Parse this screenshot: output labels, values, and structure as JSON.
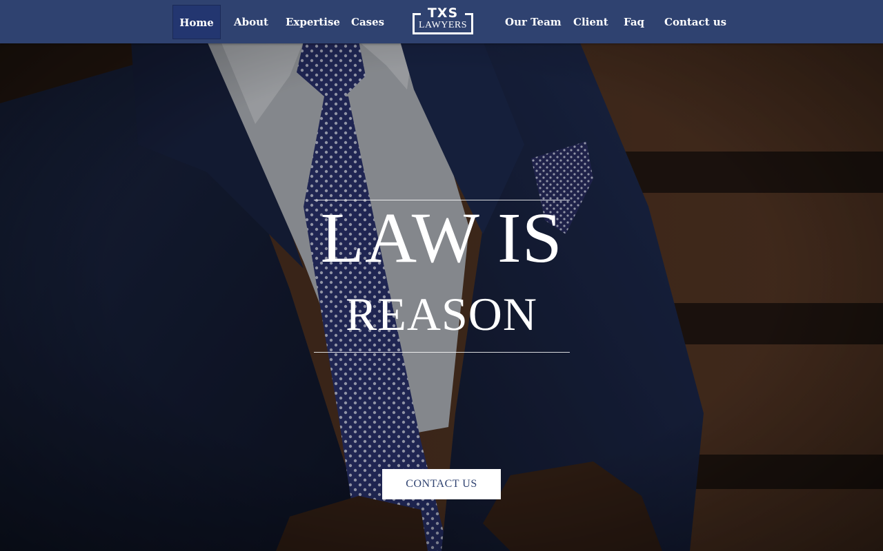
{
  "nav": {
    "left_items": [
      {
        "label": "Home",
        "active": true
      },
      {
        "label": "About",
        "active": false
      },
      {
        "label": "Expertise",
        "active": false
      },
      {
        "label": "Cases",
        "active": false
      }
    ],
    "right_items": [
      {
        "label": "Our Team",
        "active": false
      },
      {
        "label": "Client",
        "active": false
      },
      {
        "label": "Faq",
        "active": false
      },
      {
        "label": "Contact us",
        "active": false
      }
    ]
  },
  "logo": {
    "top_text": "TXS",
    "bottom_text": "LAWYERS"
  },
  "hero": {
    "headline_line1": "LAW IS",
    "headline_line2": "REASON",
    "cta_label": "CONTACT US",
    "background_subject": "man in navy suit with polka-dot tie"
  },
  "colors": {
    "nav_background": "#2f4270",
    "nav_active": "#233670",
    "cta_background": "#ffffff",
    "cta_text": "#2f4270"
  }
}
